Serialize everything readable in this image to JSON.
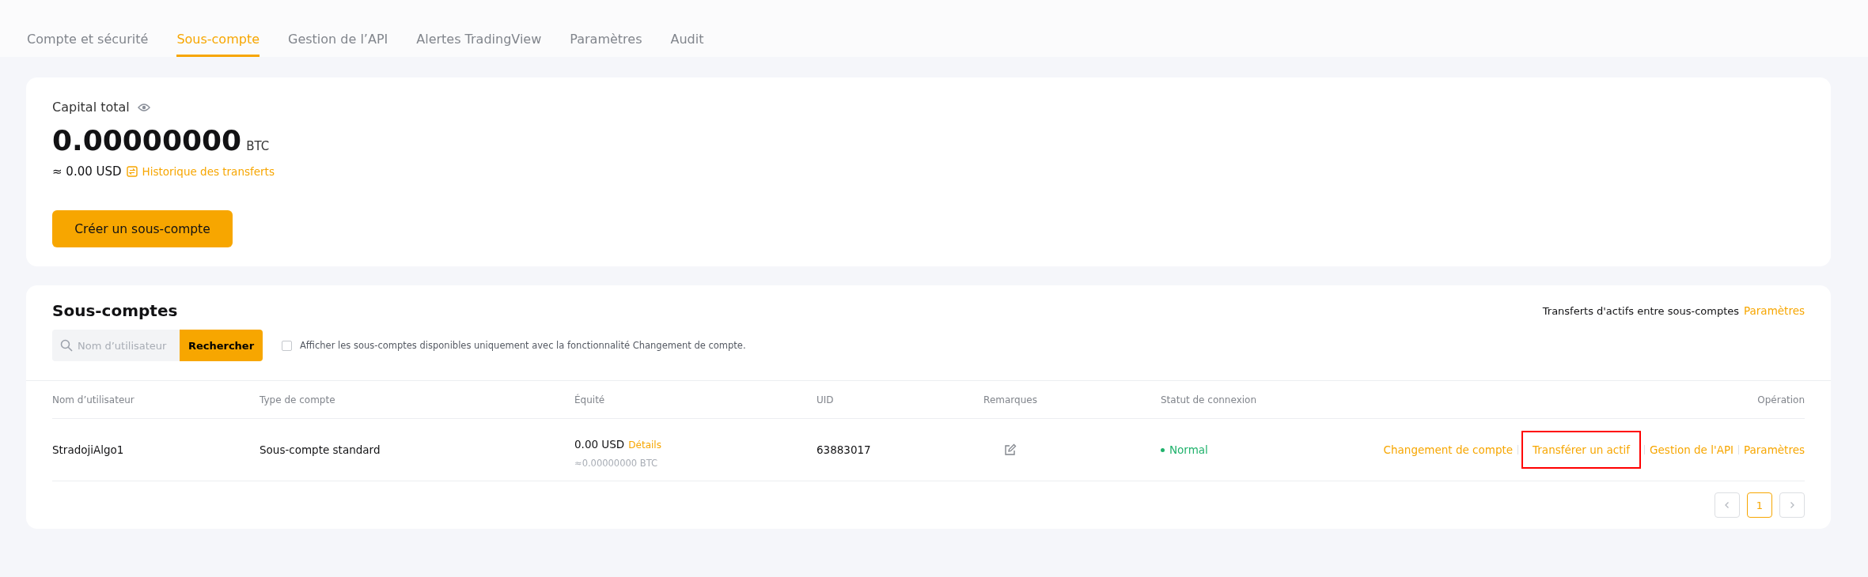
{
  "tabs": [
    {
      "label": "Compte et sécurité",
      "selected": false
    },
    {
      "label": "Sous-compte",
      "selected": true
    },
    {
      "label": "Gestion de l’API",
      "selected": false
    },
    {
      "label": "Alertes TradingView",
      "selected": false
    },
    {
      "label": "Paramètres",
      "selected": false
    },
    {
      "label": "Audit",
      "selected": false
    }
  ],
  "capital": {
    "label": "Capital total",
    "amount": "0.00000000",
    "unit": "BTC",
    "usd": "≈ 0.00 USD",
    "history_link": "Historique des transferts",
    "create_button": "Créer un sous-compte"
  },
  "subaccounts": {
    "title": "Sous-comptes",
    "transfer_text": "Transferts d'actifs entre sous-comptes",
    "transfer_link": "Paramètres",
    "search": {
      "placeholder": "Nom d’utilisateur",
      "button": "Rechercher"
    },
    "filter": {
      "label": "Afficher les sous-comptes disponibles uniquement avec la fonctionnalité Changement de compte.",
      "checked": false
    },
    "columns": [
      "Nom d’utilisateur",
      "Type de compte",
      "Équité",
      "UID",
      "Remarques",
      "Statut de connexion",
      "Opération"
    ],
    "rows": [
      {
        "username": "StradojiAlgo1",
        "type": "Sous-compte standard",
        "equity_usd": "0.00 USD",
        "details": "Détails",
        "equity_btc": "≈0.00000000 BTC",
        "uid": "63883017",
        "status": "Normal",
        "color": "#20b26c",
        "operations": [
          {
            "label": "Changement de compte",
            "highlighted": false
          },
          {
            "label": "Transférer un actif",
            "highlighted": true
          },
          {
            "label": "Gestion de l'API",
            "highlighted": false
          },
          {
            "label": "Paramètres",
            "highlighted": false
          }
        ]
      }
    ],
    "pagination": {
      "pages": [
        {
          "label": "1",
          "selected": true
        }
      ]
    }
  }
}
